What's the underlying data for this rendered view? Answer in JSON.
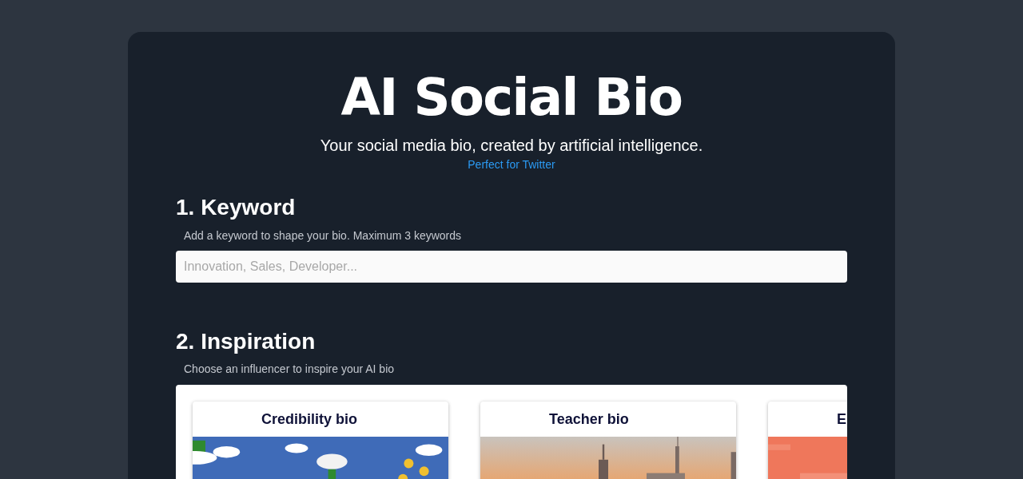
{
  "header": {
    "title": "AI Social Bio",
    "subtitle": "Your social media bio, created by artificial intelligence.",
    "link": "Perfect for Twitter"
  },
  "keyword": {
    "heading": "1. Keyword",
    "hint": "Add a keyword to shape your bio. Maximum 3 keywords",
    "placeholder": "Innovation, Sales, Developer..."
  },
  "inspiration": {
    "heading": "2. Inspiration",
    "hint": "Choose an influencer to inspire your AI bio",
    "cards": [
      {
        "title": "Credibility bio"
      },
      {
        "title": "Teacher bio"
      },
      {
        "title": "E"
      }
    ]
  }
}
